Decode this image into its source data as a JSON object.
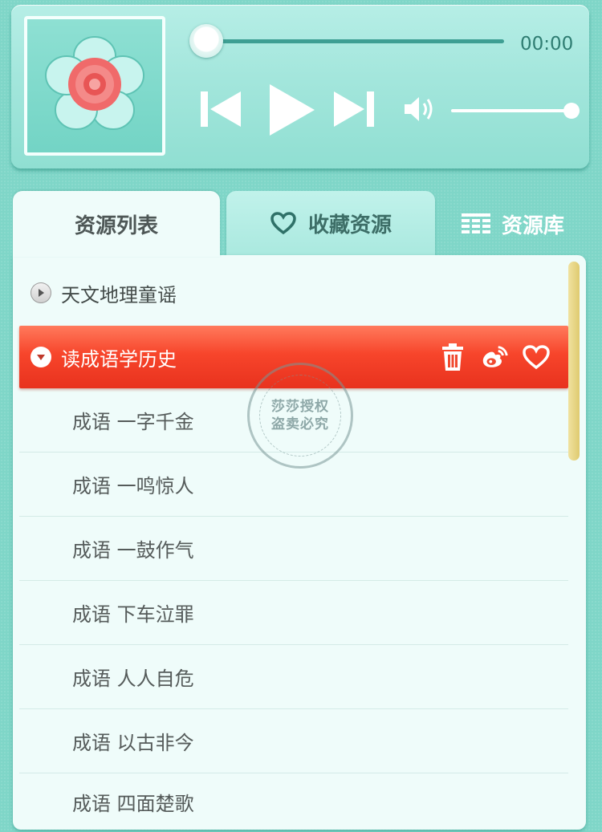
{
  "player": {
    "time": "00:00",
    "progress": 0,
    "volume": 1
  },
  "tabs": [
    {
      "label": "资源列表",
      "active": true
    },
    {
      "label": "收藏资源",
      "active": false
    },
    {
      "label": "资源库",
      "active": false
    }
  ],
  "groups": [
    {
      "label": "天文地理童谣",
      "expanded": false
    },
    {
      "label": "读成语学历史",
      "expanded": true
    }
  ],
  "items": [
    "成语 一字千金",
    "成语 一鸣惊人",
    "成语 一鼓作气",
    "成语 下车泣罪",
    "成语 人人自危",
    "成语 以古非今",
    "成语 四面楚歌"
  ],
  "watermark": {
    "line1": "莎莎授权",
    "line2": "盗卖必究"
  },
  "colors": {
    "accent_teal": "#7fd6c8",
    "selected_row": "#f7452b",
    "scrollbar": "#dfca6f"
  }
}
